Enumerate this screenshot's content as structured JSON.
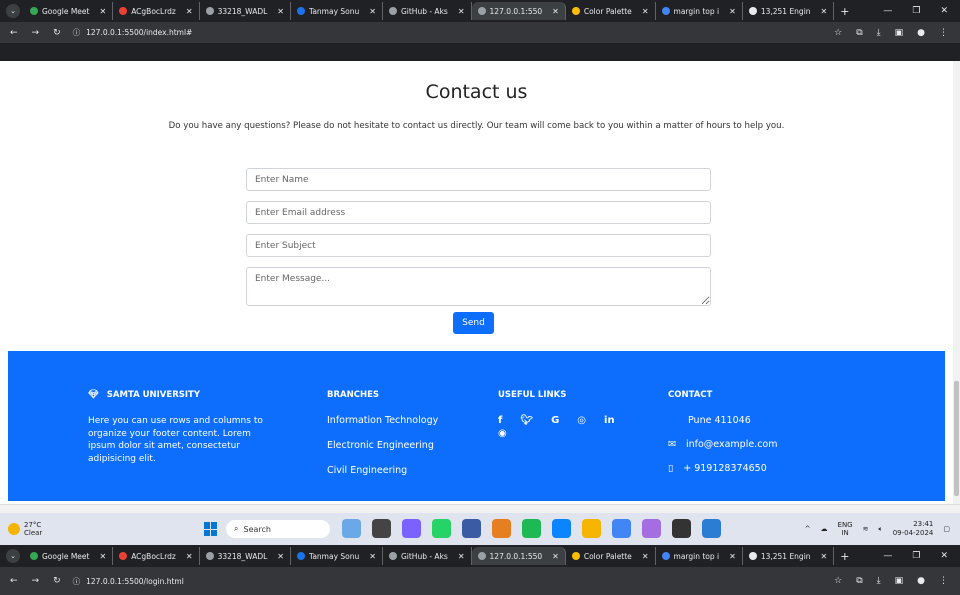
{
  "browser_top": {
    "tabs": [
      {
        "label": "Google Meet",
        "color": "#34a853"
      },
      {
        "label": "ACgBocLrdz",
        "color": "#ea4335"
      },
      {
        "label": "33218_WADL",
        "color": "#9aa0a6"
      },
      {
        "label": "Tanmay Sonu",
        "color": "#1a73e8"
      },
      {
        "label": "GitHub - Aks",
        "color": "#9aa0a6"
      },
      {
        "label": "127.0.0.1:550",
        "color": "#9aa0a6",
        "active": true
      },
      {
        "label": "Color Palette",
        "color": "#fbbc04"
      },
      {
        "label": "margin top i",
        "color": "#4285f4"
      },
      {
        "label": "13,251 Engin",
        "color": "#e8eaed"
      }
    ],
    "url": "127.0.0.1:5500/index.html#"
  },
  "page": {
    "title": "Contact us",
    "subtitle": "Do you have any questions? Please do not hesitate to contact us directly. Our team will come back to you within a matter of hours to help you.",
    "form": {
      "name_placeholder": "Enter Name",
      "email_placeholder": "Enter Email address",
      "subject_placeholder": "Enter Subject",
      "message_placeholder": "Enter Message...",
      "send_label": "Send"
    }
  },
  "footer": {
    "about": {
      "heading": "SAMTA UNIVERSITY",
      "text": "Here you can use rows and columns to organize your footer content. Lorem ipsum dolor sit amet, consectetur adipisicing elit."
    },
    "branches": {
      "heading": "BRANCHES",
      "items": [
        "Information Technology",
        "Electronic Engineering",
        "Civil Engineering"
      ]
    },
    "useful_links": {
      "heading": "USEFUL LINKS"
    },
    "contact": {
      "heading": "CONTACT",
      "address": "Pune 411046",
      "email": "info@example.com",
      "phone": "+ 919128374650"
    },
    "color": "#0d6efd"
  },
  "taskbar": {
    "temperature": "27°C",
    "weather": "Clear",
    "search_label": "Search",
    "lang_top": "ENG",
    "lang_bottom": "IN",
    "time": "23:41",
    "date": "09-04-2024"
  },
  "browser_bottom": {
    "url": "127.0.0.1:5500/login.html"
  }
}
